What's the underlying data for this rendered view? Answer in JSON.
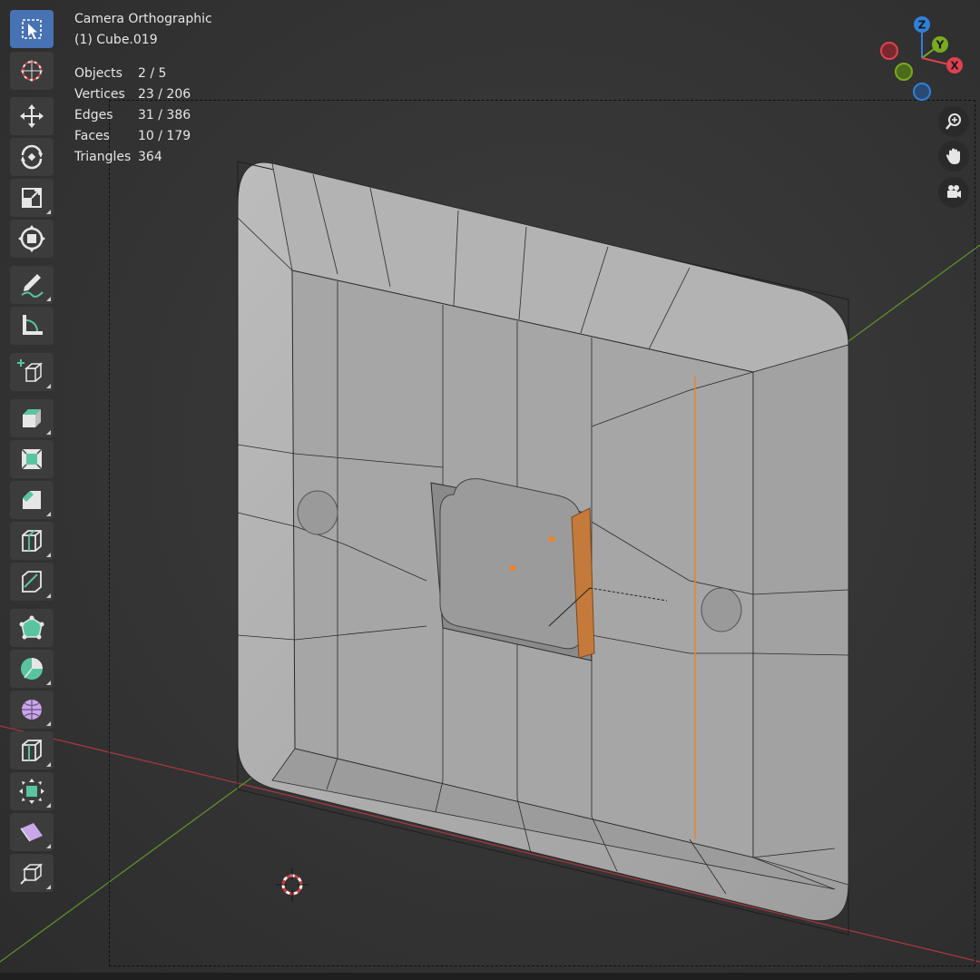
{
  "viewport": {
    "title": "Camera Orthographic",
    "object_name": "(1) Cube.019",
    "stats": [
      {
        "label": "Objects",
        "value": "2 / 5"
      },
      {
        "label": "Vertices",
        "value": "23 / 206"
      },
      {
        "label": "Edges",
        "value": "31 / 386"
      },
      {
        "label": "Faces",
        "value": "10 / 179"
      },
      {
        "label": "Triangles",
        "value": "364"
      }
    ]
  },
  "gizmo": {
    "x": "X",
    "y": "Y",
    "z": "Z",
    "x_color": "#e0414f",
    "y_color": "#7aaa22",
    "z_color": "#2f80d8"
  },
  "toolbar": {
    "tools": [
      "select-box-icon",
      "cursor-icon",
      "move-icon",
      "rotate-icon",
      "scale-icon",
      "transform-icon",
      "annotate-icon",
      "measure-icon",
      "add-cube-icon",
      "extrude-region-icon",
      "inset-faces-icon",
      "bevel-icon",
      "loop-cut-icon",
      "knife-icon",
      "poly-build-icon",
      "spin-icon",
      "smooth-icon",
      "edge-slide-icon",
      "shrink-fatten-icon",
      "shear-icon",
      "rip-region-icon"
    ]
  },
  "navigation": [
    "zoom-icon",
    "hand-pan-icon",
    "camera-view-icon"
  ],
  "colors": {
    "active_tool": "#4772b3",
    "selection": "#e8842b",
    "x_axis": "#c0404a",
    "y_axis": "#5f8f2a"
  }
}
